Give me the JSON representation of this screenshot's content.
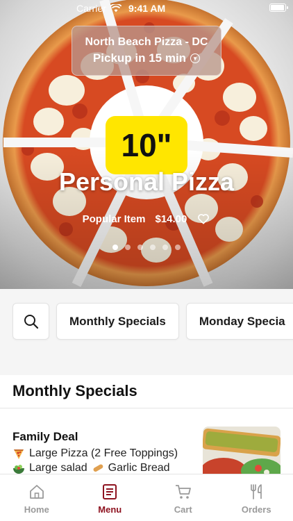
{
  "status": {
    "carrier": "Carrier",
    "time": "9:41 AM"
  },
  "store": {
    "name": "North Beach Pizza - DC",
    "pickup": "Pickup in 15 min"
  },
  "hero": {
    "badge": "10\"",
    "title": "Personal Pizza",
    "tag": "Popular Item",
    "price": "$14.00",
    "slide_count": 6,
    "active_slide": 1
  },
  "chips": [
    {
      "label": "Monthly Specials"
    },
    {
      "label": "Monday Specia"
    }
  ],
  "section": {
    "title": "Monthly Specials"
  },
  "card": {
    "title": "Family Deal",
    "line1": "Large Pizza (2 Free Toppings)",
    "line2a": "Large salad",
    "line2b": "Garlic Bread"
  },
  "tabs": [
    {
      "label": "Home",
      "icon": "home-icon"
    },
    {
      "label": "Menu",
      "icon": "menu-icon",
      "active": true
    },
    {
      "label": "Cart",
      "icon": "cart-icon"
    },
    {
      "label": "Orders",
      "icon": "orders-icon"
    }
  ],
  "colors": {
    "accent": "#8e1320",
    "badge": "#ffe600"
  }
}
